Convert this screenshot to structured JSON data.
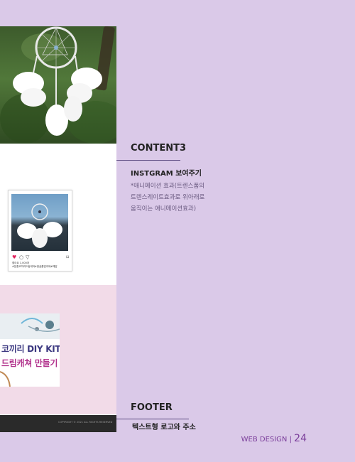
{
  "post": {
    "likes": "좋아요 1,000개",
    "tags": "#분홍코끼리드림캐쳐#한글졸업과제#예감"
  },
  "kit": {
    "line1": "코끼리 DIY KIT",
    "line2": "드림캐쳐 만들기"
  },
  "footer_mock": {
    "text": "COPYRIGHT © 2021 ALL RIGHTS RESERVED"
  },
  "content3": {
    "heading": "CONTENT3",
    "subheading": "INSTGRAM 보여주기",
    "desc_lines": [
      "*애니메이션 효과(트렌스폼의",
      "트렌스레이트효과로 위아래로",
      "움직이는 애니메이션효과)"
    ]
  },
  "footer_section": {
    "heading": "FOOTER",
    "subheading": "텍스트형 로고와 주소"
  },
  "page": {
    "label": "WEB DESIGN",
    "separator": "|",
    "number": "24"
  },
  "colors": {
    "background": "#dac9e8",
    "accent": "#7a3d9a",
    "line": "#5b4a80",
    "pink_band": "#f2dbe8"
  },
  "icons": {
    "heart": "heart-icon",
    "comment": "comment-icon",
    "share": "share-icon",
    "bookmark": "bookmark-icon"
  }
}
